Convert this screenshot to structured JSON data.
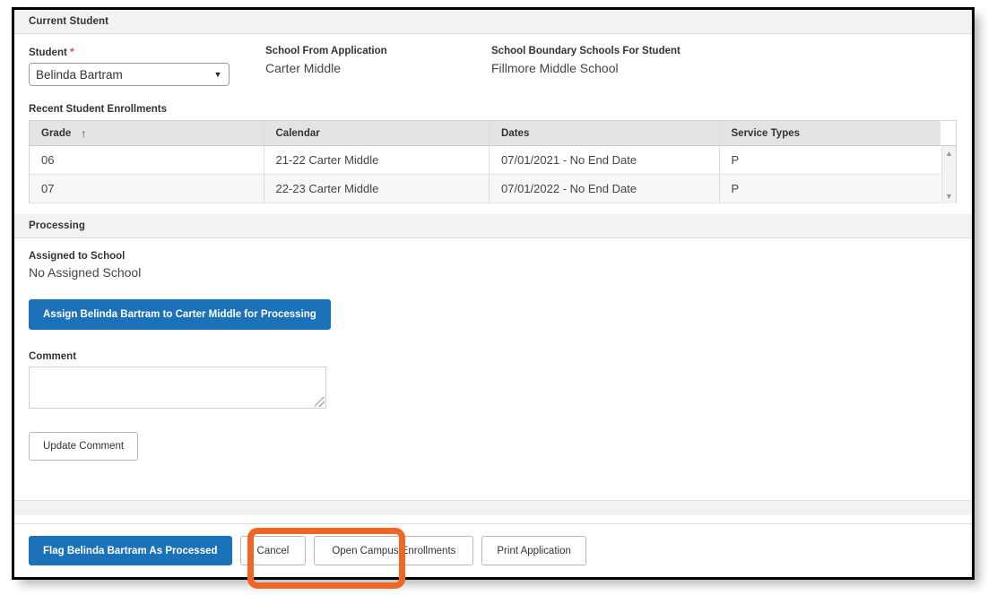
{
  "sections": {
    "current_student": {
      "title": "Current Student",
      "student_label": "Student",
      "required_marker": "*",
      "student_value": "Belinda Bartram",
      "caret_icon": "▼",
      "school_from_application_label": "School From Application",
      "school_from_application_value": "Carter Middle",
      "boundary_label": "School Boundary Schools For Student",
      "boundary_value": "Fillmore Middle School"
    },
    "enrollments": {
      "title": "Recent Student Enrollments",
      "columns": [
        "Grade",
        "Calendar",
        "Dates",
        "Service Types"
      ],
      "sort_column": "Grade",
      "sort_arrow": "↑",
      "scroll_up_icon": "▲",
      "scroll_down_icon": "▼",
      "rows": [
        {
          "grade": "06",
          "calendar": "21-22 Carter Middle",
          "dates": "07/01/2021 - No End Date",
          "service_types": "P"
        },
        {
          "grade": "07",
          "calendar": "22-23 Carter Middle",
          "dates": "07/01/2022 - No End Date",
          "service_types": "P"
        }
      ]
    },
    "processing": {
      "title": "Processing",
      "assigned_label": "Assigned to School",
      "assigned_value": "No Assigned School",
      "assign_button": "Assign Belinda Bartram to Carter Middle for Processing",
      "comment_label": "Comment",
      "comment_value": "",
      "update_comment_button": "Update Comment"
    }
  },
  "footer": {
    "flag_button": "Flag Belinda Bartram As Processed",
    "cancel_button": "Cancel",
    "open_enrollments_button": "Open Campus Enrollments",
    "print_button": "Print Application"
  },
  "colors": {
    "primary_blue": "#1b72b8",
    "highlight_orange": "#ef6724",
    "section_header_bg": "#f2f2f2",
    "grid_header_bg": "#e3e3e3",
    "required_red": "#d9534f"
  }
}
